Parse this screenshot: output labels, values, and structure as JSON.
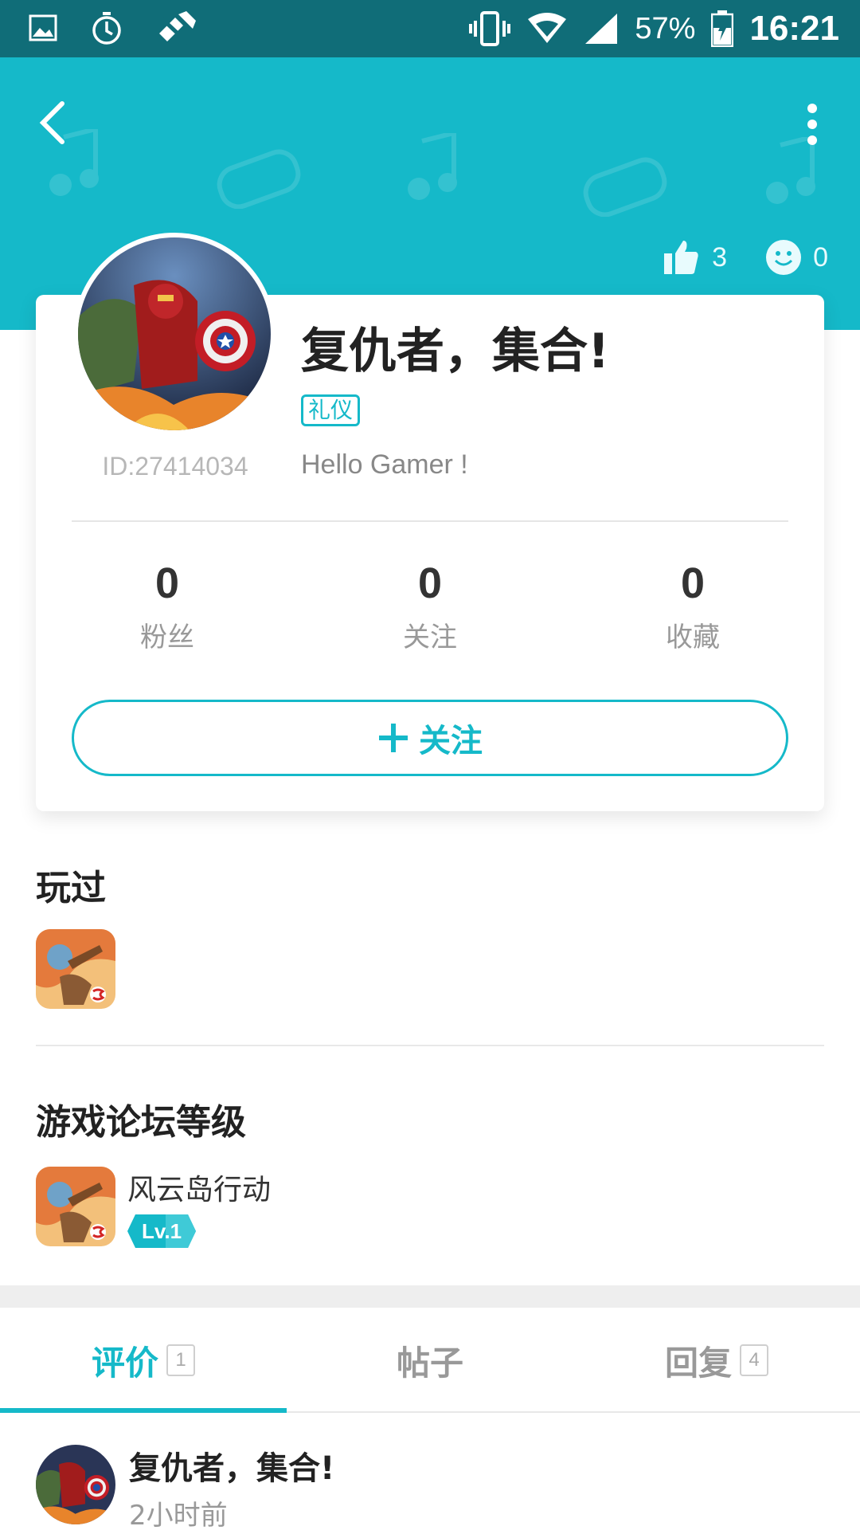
{
  "status_bar": {
    "battery": "57%",
    "time": "16:21",
    "icons": [
      "image-icon",
      "stopwatch-icon",
      "tools-icon",
      "vibrate-icon",
      "wifi-icon",
      "signal-icon",
      "battery-icon"
    ]
  },
  "header": {
    "likes": "3",
    "visitors": "0"
  },
  "profile": {
    "name": "复仇者，集合!",
    "tag": "礼仪",
    "id": "ID:27414034",
    "signature": "Hello Gamer !",
    "stats": [
      {
        "value": "0",
        "label": "粉丝"
      },
      {
        "value": "0",
        "label": "关注"
      },
      {
        "value": "0",
        "label": "收藏"
      }
    ],
    "follow_label": "关注"
  },
  "played": {
    "title": "玩过"
  },
  "forum_level": {
    "title": "游戏论坛等级",
    "game_name": "风云岛行动",
    "level": "Lv.1"
  },
  "tabs": [
    {
      "label": "评价",
      "count": "1"
    },
    {
      "label": "帖子",
      "count": ""
    },
    {
      "label": "回复",
      "count": "4"
    }
  ],
  "review": {
    "author": "复仇者，集合!",
    "time": "2小时前"
  },
  "colors": {
    "accent": "#15b9c9",
    "status_bar": "#106d78"
  }
}
